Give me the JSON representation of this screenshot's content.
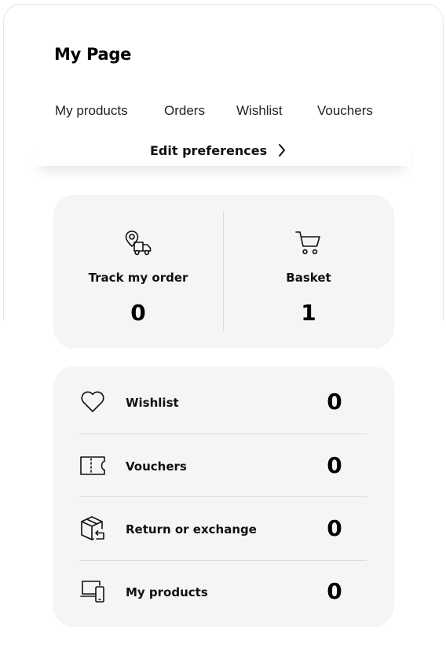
{
  "page": {
    "title": "My Page"
  },
  "tabs": [
    {
      "label": "My products"
    },
    {
      "label": "Orders"
    },
    {
      "label": "Wishlist"
    },
    {
      "label": "Vouchers"
    }
  ],
  "preferences": {
    "label": "Edit preferences",
    "icon": "chevron-right-icon"
  },
  "summary": [
    {
      "label": "Track my order",
      "count": "0",
      "icon": "delivery-truck-location-icon"
    },
    {
      "label": "Basket",
      "count": "1",
      "icon": "shopping-cart-icon"
    }
  ],
  "list": [
    {
      "label": "Wishlist",
      "count": "0",
      "icon": "heart-icon"
    },
    {
      "label": "Vouchers",
      "count": "0",
      "icon": "ticket-icon"
    },
    {
      "label": "Return or exchange",
      "count": "0",
      "icon": "box-return-icon"
    },
    {
      "label": "My products",
      "count": "0",
      "icon": "devices-icon"
    }
  ]
}
